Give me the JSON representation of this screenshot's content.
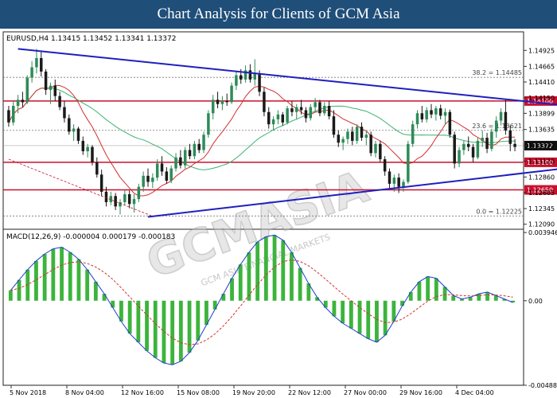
{
  "header": {
    "title": "Chart Analysis for Clients of GCM Asia"
  },
  "watermark": {
    "text": "GCMASIA",
    "subtext": "GCM ASIA FINANCIAL MARKETS"
  },
  "colors": {
    "bull": "#2e8b57",
    "bear": "#1a1a1a",
    "trendline": "#1f1fbf",
    "level": "#c8102e",
    "ma_red": "#d43030",
    "ma_green": "#3cb371",
    "macd_line": "#1e3ccf",
    "macd_signal": "#d43030",
    "macd_hist": "#3cb43c"
  },
  "chart_data": [
    {
      "type": "candlestick",
      "symbol_info": "EURUSD,H4  1.13415 1.13452 1.13341 1.13372",
      "x_tick_labels": [
        "5 Nov 2018",
        "8 Nov 04:00",
        "12 Nov 16:00",
        "15 Nov 08:00",
        "19 Nov 20:00",
        "22 Nov 12:00",
        "27 Nov 00:00",
        "29 Nov 16:00",
        "4 Dec 04:00"
      ],
      "y_tick_labels": [
        "1.14925",
        "1.14665",
        "1.14410",
        "1.14150",
        "1.13899",
        "1.13635",
        "1.13372",
        "1.13120",
        "1.12860",
        "1.12605",
        "1.12345",
        "1.12090"
      ],
      "ylim": [
        1.1206,
        1.1502
      ],
      "levels": [
        {
          "label": "1.14100",
          "value": 1.141
        },
        {
          "label": "1.13100",
          "value": 1.131
        },
        {
          "label": "1.12650",
          "value": 1.1265
        }
      ],
      "current_price": {
        "label": "1.13372",
        "value": 1.13372
      },
      "fib_levels": [
        {
          "label": "38.2 = 1.14485",
          "value": 1.14485
        },
        {
          "label": "23.6 = 1.13621",
          "value": 1.13621
        },
        {
          "label": "0.0 = 1.12225",
          "value": 1.12225
        }
      ],
      "trendlines": [
        {
          "name": "resistance",
          "points": [
            [
              2,
              1.1495
            ],
            [
              140,
              1.1387
            ]
          ]
        },
        {
          "name": "support",
          "points": [
            [
              30,
              1.1221
            ],
            [
              140,
              1.1318
            ]
          ]
        }
      ],
      "swing_line": [
        [
          0,
          1.1315
        ],
        [
          31,
          1.1222
        ]
      ],
      "candles": [
        [
          1.1395,
          1.1402,
          1.1368,
          1.1375
        ],
        [
          1.1375,
          1.141,
          1.137,
          1.1402
        ],
        [
          1.1402,
          1.142,
          1.139,
          1.1412
        ],
        [
          1.1412,
          1.1425,
          1.14,
          1.1408
        ],
        [
          1.1408,
          1.1452,
          1.1405,
          1.1448
        ],
        [
          1.1448,
          1.1475,
          1.144,
          1.1465
        ],
        [
          1.1465,
          1.1495,
          1.1455,
          1.148
        ],
        [
          1.148,
          1.149,
          1.145,
          1.1458
        ],
        [
          1.1458,
          1.1462,
          1.142,
          1.1428
        ],
        [
          1.1428,
          1.144,
          1.1405,
          1.1435
        ],
        [
          1.1435,
          1.1445,
          1.141,
          1.1418
        ],
        [
          1.1418,
          1.1425,
          1.1395,
          1.14
        ],
        [
          1.14,
          1.141,
          1.1375,
          1.1382
        ],
        [
          1.1382,
          1.1388,
          1.1355,
          1.136
        ],
        [
          1.136,
          1.1372,
          1.1345,
          1.1365
        ],
        [
          1.1365,
          1.1368,
          1.134,
          1.1345
        ],
        [
          1.1345,
          1.1352,
          1.1322,
          1.1328
        ],
        [
          1.1328,
          1.134,
          1.1318,
          1.1335
        ],
        [
          1.1335,
          1.1338,
          1.1305,
          1.131
        ],
        [
          1.131,
          1.1318,
          1.1285,
          1.129
        ],
        [
          1.129,
          1.1298,
          1.1255,
          1.1262
        ],
        [
          1.1262,
          1.127,
          1.1238,
          1.1245
        ],
        [
          1.1245,
          1.1262,
          1.124,
          1.1255
        ],
        [
          1.1255,
          1.126,
          1.1232,
          1.1238
        ],
        [
          1.1238,
          1.125,
          1.1225,
          1.1245
        ],
        [
          1.1245,
          1.1265,
          1.124,
          1.1258
        ],
        [
          1.1258,
          1.1264,
          1.1235,
          1.1242
        ],
        [
          1.1242,
          1.1258,
          1.1228,
          1.125
        ],
        [
          1.125,
          1.1275,
          1.1245,
          1.127
        ],
        [
          1.127,
          1.1295,
          1.1262,
          1.1288
        ],
        [
          1.1288,
          1.13,
          1.127,
          1.1278
        ],
        [
          1.1278,
          1.1292,
          1.1268,
          1.1285
        ],
        [
          1.1285,
          1.1315,
          1.128,
          1.1308
        ],
        [
          1.1308,
          1.132,
          1.1288,
          1.1295
        ],
        [
          1.1295,
          1.1302,
          1.1275,
          1.128
        ],
        [
          1.128,
          1.1305,
          1.1276,
          1.13
        ],
        [
          1.13,
          1.1325,
          1.1295,
          1.1318
        ],
        [
          1.1318,
          1.133,
          1.13,
          1.1305
        ],
        [
          1.1305,
          1.1335,
          1.13,
          1.133
        ],
        [
          1.133,
          1.134,
          1.1315,
          1.132
        ],
        [
          1.132,
          1.1345,
          1.1315,
          1.134
        ],
        [
          1.134,
          1.1348,
          1.1325,
          1.133
        ],
        [
          1.133,
          1.136,
          1.1325,
          1.1355
        ],
        [
          1.1355,
          1.1395,
          1.135,
          1.139
        ],
        [
          1.139,
          1.142,
          1.138,
          1.1412
        ],
        [
          1.1412,
          1.1425,
          1.1398,
          1.1405
        ],
        [
          1.1405,
          1.1418,
          1.1395,
          1.141
        ],
        [
          1.141,
          1.1422,
          1.1402,
          1.1408
        ],
        [
          1.1408,
          1.144,
          1.1405,
          1.1435
        ],
        [
          1.1435,
          1.1458,
          1.1428,
          1.1452
        ],
        [
          1.1452,
          1.1462,
          1.1438,
          1.1445
        ],
        [
          1.1445,
          1.1468,
          1.144,
          1.146
        ],
        [
          1.146,
          1.147,
          1.144,
          1.1445
        ],
        [
          1.1445,
          1.1478,
          1.1435,
          1.1455
        ],
        [
          1.1455,
          1.146,
          1.1418,
          1.1425
        ],
        [
          1.1425,
          1.1432,
          1.1385,
          1.1392
        ],
        [
          1.1392,
          1.14,
          1.1365,
          1.1372
        ],
        [
          1.1372,
          1.1385,
          1.1362,
          1.138
        ],
        [
          1.138,
          1.1395,
          1.1372,
          1.1388
        ],
        [
          1.1388,
          1.1392,
          1.137,
          1.1375
        ],
        [
          1.1375,
          1.1402,
          1.1372,
          1.1398
        ],
        [
          1.1398,
          1.141,
          1.1385,
          1.1392
        ],
        [
          1.1392,
          1.1405,
          1.138,
          1.14
        ],
        [
          1.14,
          1.1412,
          1.1388,
          1.1395
        ],
        [
          1.1395,
          1.14,
          1.1375,
          1.1382
        ],
        [
          1.1382,
          1.1405,
          1.1378,
          1.14
        ],
        [
          1.14,
          1.1415,
          1.1392,
          1.1408
        ],
        [
          1.1408,
          1.1412,
          1.1385,
          1.139
        ],
        [
          1.139,
          1.1408,
          1.1386,
          1.1402
        ],
        [
          1.1402,
          1.141,
          1.138,
          1.1385
        ],
        [
          1.1385,
          1.1395,
          1.135,
          1.1355
        ],
        [
          1.1355,
          1.1362,
          1.1335,
          1.1342
        ],
        [
          1.1342,
          1.1352,
          1.133,
          1.1348
        ],
        [
          1.1348,
          1.1365,
          1.134,
          1.136
        ],
        [
          1.136,
          1.1368,
          1.1338,
          1.1345
        ],
        [
          1.1345,
          1.1372,
          1.134,
          1.1368
        ],
        [
          1.1368,
          1.1375,
          1.1345,
          1.135
        ],
        [
          1.135,
          1.1362,
          1.1338,
          1.1355
        ],
        [
          1.1355,
          1.136,
          1.132,
          1.1325
        ],
        [
          1.1325,
          1.1345,
          1.1318,
          1.134
        ],
        [
          1.134,
          1.1345,
          1.131,
          1.1315
        ],
        [
          1.1315,
          1.132,
          1.1288,
          1.1295
        ],
        [
          1.1295,
          1.13,
          1.1268,
          1.1275
        ],
        [
          1.1275,
          1.129,
          1.1262,
          1.1285
        ],
        [
          1.1285,
          1.1292,
          1.126,
          1.127
        ],
        [
          1.127,
          1.1282,
          1.1262,
          1.1278
        ],
        [
          1.1278,
          1.1345,
          1.1275,
          1.134
        ],
        [
          1.134,
          1.1378,
          1.1335,
          1.1372
        ],
        [
          1.1372,
          1.1395,
          1.1365,
          1.139
        ],
        [
          1.139,
          1.1402,
          1.1375,
          1.138
        ],
        [
          1.138,
          1.14,
          1.1375,
          1.1395
        ],
        [
          1.1395,
          1.1405,
          1.1382,
          1.1388
        ],
        [
          1.1388,
          1.1402,
          1.1378,
          1.1398
        ],
        [
          1.1398,
          1.1404,
          1.138,
          1.1386
        ],
        [
          1.1386,
          1.1398,
          1.1372,
          1.1392
        ],
        [
          1.1392,
          1.1396,
          1.135,
          1.1355
        ],
        [
          1.1355,
          1.136,
          1.13,
          1.1308
        ],
        [
          1.1308,
          1.1335,
          1.1302,
          1.133
        ],
        [
          1.133,
          1.1345,
          1.1322,
          1.134
        ],
        [
          1.134,
          1.1352,
          1.1328,
          1.1335
        ],
        [
          1.1335,
          1.134,
          1.131,
          1.1318
        ],
        [
          1.1318,
          1.135,
          1.1315,
          1.1345
        ],
        [
          1.1345,
          1.1362,
          1.1335,
          1.135
        ],
        [
          1.135,
          1.1358,
          1.1325,
          1.1332
        ],
        [
          1.1332,
          1.1365,
          1.1328,
          1.136
        ],
        [
          1.136,
          1.1385,
          1.135,
          1.1378
        ],
        [
          1.1378,
          1.1398,
          1.137,
          1.1392
        ],
        [
          1.1392,
          1.1412,
          1.1355,
          1.1362
        ],
        [
          1.1362,
          1.137,
          1.1328,
          1.134
        ],
        [
          1.134,
          1.1348,
          1.1328,
          1.1335
        ]
      ]
    },
    {
      "type": "line",
      "title": "MACD(12,26,9) -0.000004 0.000179 -0.000183",
      "y_tick_labels": [
        "0.003946",
        "0.00",
        "-0.004888"
      ],
      "ylim": [
        -0.00489,
        0.00395
      ],
      "series": [
        {
          "name": "MACD",
          "values": [
            0.0006,
            0.0012,
            0.0018,
            0.0023,
            0.0027,
            0.003,
            0.0031,
            0.0028,
            0.0024,
            0.0018,
            0.0011,
            0.0004,
            -0.0004,
            -0.0012,
            -0.0019,
            -0.0024,
            -0.0029,
            -0.0033,
            -0.0036,
            -0.0037,
            -0.0035,
            -0.003,
            -0.0023,
            -0.0014,
            -0.0005,
            0.0004,
            0.0013,
            0.0021,
            0.0028,
            0.0034,
            0.0037,
            0.0038,
            0.0035,
            0.0028,
            0.0019,
            0.001,
            0.0002,
            -0.0004,
            -0.0009,
            -0.0013,
            -0.0016,
            -0.0019,
            -0.0022,
            -0.0024,
            -0.002,
            -0.0012,
            -0.0003,
            0.0005,
            0.0011,
            0.0014,
            0.0013,
            0.0008,
            0.0003,
            0.0001,
            0.0002,
            0.0004,
            0.0005,
            0.0003,
            0.0001,
            -0.0001
          ]
        }
      ]
    }
  ]
}
